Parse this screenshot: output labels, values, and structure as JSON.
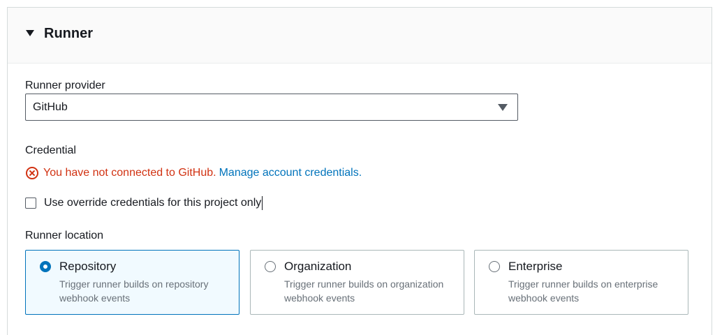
{
  "panel": {
    "title": "Runner"
  },
  "runner_provider": {
    "label": "Runner provider",
    "selected": "GitHub"
  },
  "credential": {
    "label": "Credential",
    "error_text": "You have not connected to GitHub.",
    "link_text": "Manage account credentials.",
    "override_checkbox_label": "Use override credentials for this project only",
    "override_checked": false
  },
  "runner_location": {
    "label": "Runner location",
    "options": [
      {
        "title": "Repository",
        "description": "Trigger runner builds on repository webhook events",
        "selected": true
      },
      {
        "title": "Organization",
        "description": "Trigger runner builds on organization webhook events",
        "selected": false
      },
      {
        "title": "Enterprise",
        "description": "Trigger runner builds on enterprise webhook events",
        "selected": false
      }
    ]
  },
  "colors": {
    "error": "#d13212",
    "link": "#0073bb",
    "selected_border": "#0073bb",
    "selected_background": "#f1faff"
  },
  "icons": {
    "collapse": "caret-down-icon",
    "dropdown": "caret-down-icon",
    "error": "error-circle-x-icon"
  }
}
